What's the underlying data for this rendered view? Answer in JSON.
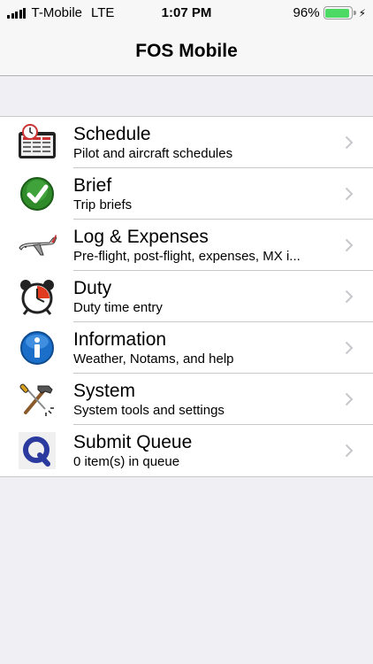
{
  "status_bar": {
    "carrier": "T-Mobile",
    "network": "LTE",
    "time": "1:07 PM",
    "battery_percent": "96%",
    "battery_level": 0.96
  },
  "nav": {
    "title": "FOS Mobile"
  },
  "menu": [
    {
      "title": "Schedule",
      "subtitle": "Pilot and aircraft schedules",
      "icon": "calendar-clock-icon"
    },
    {
      "title": "Brief",
      "subtitle": "Trip briefs",
      "icon": "checkmark-icon"
    },
    {
      "title": "Log & Expenses",
      "subtitle": "Pre-flight, post-flight, expenses, MX i...",
      "icon": "airplane-icon"
    },
    {
      "title": "Duty",
      "subtitle": "Duty time entry",
      "icon": "alarm-clock-icon"
    },
    {
      "title": "Information",
      "subtitle": "Weather, Notams, and help",
      "icon": "info-icon"
    },
    {
      "title": "System",
      "subtitle": "System tools and settings",
      "icon": "hammer-screwdriver-icon"
    },
    {
      "title": "Submit Queue",
      "subtitle": "0 item(s) in queue",
      "icon": "queue-q-icon"
    }
  ],
  "colors": {
    "background": "#efeff4",
    "battery_green": "#4cd964",
    "chevron": "#c7c7cc"
  }
}
